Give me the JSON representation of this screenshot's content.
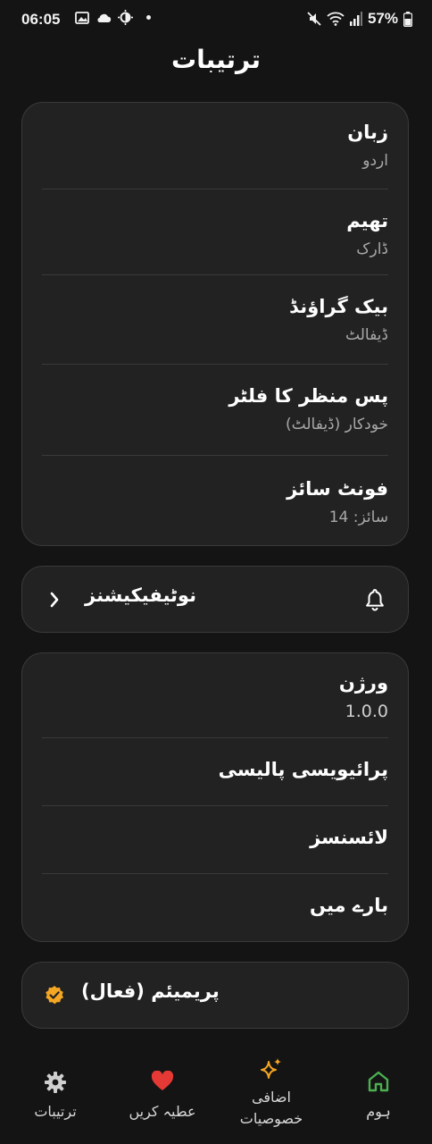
{
  "status_bar": {
    "time": "06:05",
    "battery": "57%",
    "left_icons": [
      "image-icon",
      "cloud-icon",
      "brightness-icon",
      "dot-icon"
    ],
    "right_icons": [
      "mute-icon",
      "wifi-icon",
      "signal-icon",
      "battery-icon"
    ]
  },
  "page": {
    "title": "ترتیبات"
  },
  "general": {
    "items": [
      {
        "title": "زبان",
        "value": "اردو"
      },
      {
        "title": "تھیم",
        "value": "ڈارک"
      },
      {
        "title": "بیک گراؤنڈ",
        "value": "ڈیفالٹ"
      },
      {
        "title": "پس منظر کا فلٹر",
        "value": "خودکار (ڈیفالٹ)"
      },
      {
        "title": "فونٹ سائز",
        "value": "سائز: 14"
      }
    ]
  },
  "notifications": {
    "label": "نوٹیفیکیشنز",
    "icon": "bell-icon"
  },
  "about": {
    "version_title": "ورژن",
    "version_value": "1.0.0",
    "privacy": "پرائیویسی پالیسی",
    "licenses": "لائسنسز",
    "about": "بارے میں"
  },
  "premium": {
    "label": "پریمیئم (فعال)",
    "icon": "verified-badge-icon",
    "badge_color": "#f5a623"
  },
  "bottom_nav": {
    "settings": {
      "label": "ترتیبات",
      "icon": "gear-icon"
    },
    "donate": {
      "label": "عطیہ کریں",
      "icon": "heart-icon",
      "color": "#e53935"
    },
    "extras": {
      "label_line1": "اضافی",
      "label_line2": "خصوصیات",
      "icon": "sparkles-icon",
      "color": "#f5a623"
    },
    "home": {
      "label": "ہوم",
      "icon": "home-icon",
      "color": "#4caf50"
    }
  }
}
